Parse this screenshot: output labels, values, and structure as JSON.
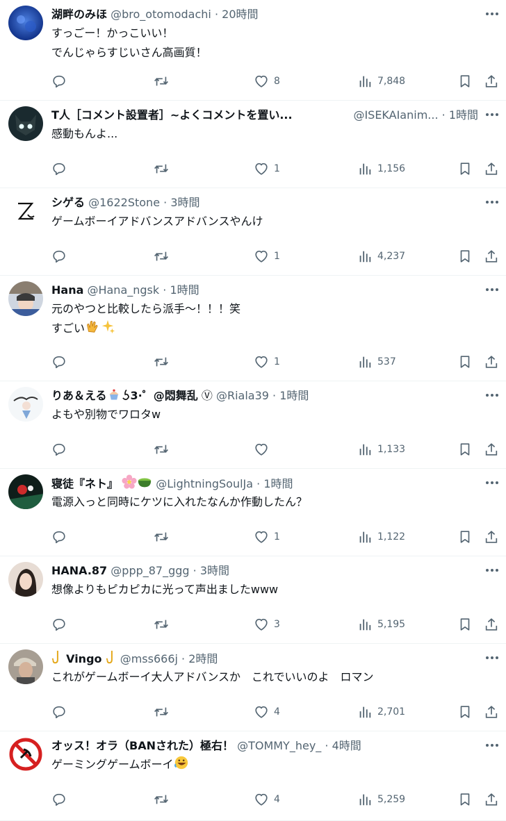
{
  "posts": [
    {
      "name": "湖畔のみほ",
      "handle": "@bro_otomodachi",
      "time": "20時間",
      "lines": [
        "すっごー！かっこいい！",
        "でんじゃらすじいさん高画質！"
      ],
      "likes": "8",
      "views": "7,848"
    },
    {
      "name": "T人［コメント設置者］~よくコメントを置い...",
      "handle": "@ISEKAIanim...",
      "time": "1時間",
      "lines": [
        "感動もんよ..."
      ],
      "likes": "1",
      "views": "1,156"
    },
    {
      "name": "シゲる",
      "handle": "@1622Stone",
      "time": "3時間",
      "lines": [
        "ゲームボーイアドバンスアドバンスやんけ"
      ],
      "likes": "1",
      "views": "4,237"
    },
    {
      "name": "Hana",
      "handle": "@Hana_ngsk",
      "time": "1時間",
      "lines": [
        "元のやつと比較したら派手～！！！笑",
        "すごい"
      ],
      "likes": "1",
      "views": "537"
    },
    {
      "name": "りあ＆える",
      "name_suffix": "3·゜@悶舞乱",
      "handle": "@Riala39",
      "time": "1時間",
      "lines": [
        "よもや別物でワロタw"
      ],
      "likes": "",
      "views": "1,133"
    },
    {
      "name": "寝徒『ネト』",
      "handle": "@LightningSoulJa",
      "time": "1時間",
      "lines": [
        "電源入っと同時にケツに入れたなんか作動したん？"
      ],
      "likes": "1",
      "views": "1,122"
    },
    {
      "name": "HANA.87",
      "handle": "@ppp_87_ggg",
      "time": "3時間",
      "lines": [
        "想像よりもピカピカに光って声出ましたwww"
      ],
      "likes": "3",
      "views": "5,195"
    },
    {
      "name": "Vingo",
      "handle": "@mss666j",
      "time": "2時間",
      "lines": [
        "これがゲームボーイ大人アドバンスか　これでいいのよ　ロマン"
      ],
      "likes": "4",
      "views": "2,701"
    },
    {
      "name": "オッス！オラ（BANされた）極右！",
      "handle": "@TOMMY_hey_",
      "time": "4時間",
      "lines": [
        "ゲーミングゲームボーイ"
      ],
      "likes": "4",
      "views": "5,259"
    }
  ],
  "dot": "·",
  "icons": {
    "more": "more-horizontal-icon",
    "reply": "reply-icon",
    "retweet": "retweet-icon",
    "like": "heart-icon",
    "views": "views-chart-icon",
    "bookmark": "bookmark-icon",
    "share": "share-icon"
  },
  "colors": {
    "text": "#0f1419",
    "muted": "#536471",
    "divider": "#eff3f4"
  }
}
